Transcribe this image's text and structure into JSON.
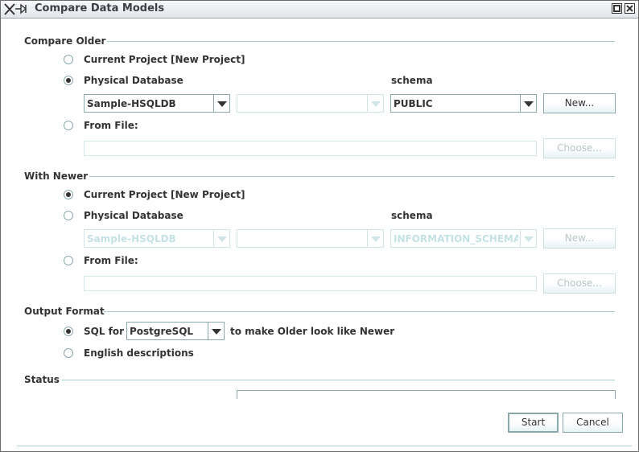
{
  "window": {
    "title": "Compare Data Models",
    "icons": [
      "application-icon",
      "maximize-icon",
      "close-icon"
    ]
  },
  "compare_older": {
    "section_title": "Compare Older",
    "current_project_label": "Current Project [New Project]",
    "physical_db_label": "Physical Database",
    "schema_label": "schema",
    "database_value": "Sample-HSQLDB",
    "catalog_value": "",
    "schema_value": "PUBLIC",
    "new_button": "New...",
    "from_file_label": "From File:",
    "file_path": "",
    "choose_button": "Choose...",
    "selected": "physical_database"
  },
  "with_newer": {
    "section_title": "With Newer",
    "current_project_label": "Current Project [New Project]",
    "physical_db_label": "Physical Database",
    "schema_label": "schema",
    "database_value": "Sample-HSQLDB",
    "catalog_value": "",
    "schema_value": "INFORMATION_SCHEMA",
    "new_button": "New...",
    "from_file_label": "From File:",
    "file_path": "",
    "choose_button": "Choose...",
    "selected": "current_project"
  },
  "output_format": {
    "section_title": "Output Format",
    "sql_for_label": "SQL for",
    "dialect_value": "PostgreSQL",
    "suffix_label": "to make Older look like Newer",
    "english_label": "English descriptions",
    "selected": "sql"
  },
  "status": {
    "section_title": "Status"
  },
  "footer": {
    "start_button": "Start",
    "cancel_button": "Cancel"
  },
  "colors": {
    "accent": "#a8cdd2",
    "border": "#8aa9ad",
    "disabled_text": "#c4e2e6"
  }
}
